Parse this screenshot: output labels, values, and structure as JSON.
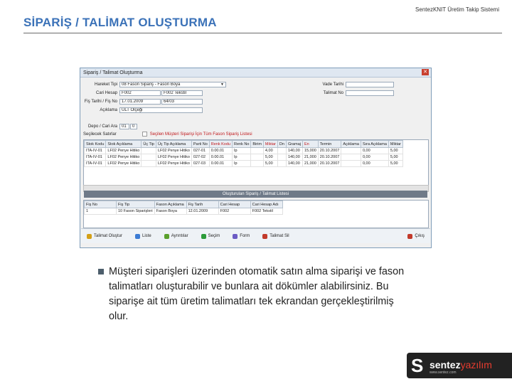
{
  "slide": {
    "title": "SİPARİŞ / TALİMAT OLUŞTURMA",
    "app_name": "SentezKNIT Üretim Takip Sistemi",
    "body_text": "Müşteri siparişleri üzerinden otomatik satın alma siparişi ve fason talimatları oluşturabilir ve bunlara ait dökümler alabilirsiniz. Bu siparişe ait tüm üretim talimatları tek ekrandan gerçekleştirilmiş olur."
  },
  "window": {
    "title": "Sipariş / Talimat Oluşturma",
    "close": "✕",
    "form": {
      "hareket_tipi_label": "Hareket Tipi",
      "hareket_tipi_value": "08 Fason Sipariş - Fason Boya",
      "cari_hesap_label": "Cari Hesap",
      "cari_hesap_code": "F002",
      "cari_hesap_name": "F002 Tekstil",
      "fis_tarihi_label": "Fiş Tarihi / Fiş No",
      "fis_tarihi_value": "17.01.2009",
      "fis_no_value": "64/03",
      "aciklama_label": "Açıklama",
      "aciklama_value": "ÜLT Ölçeği",
      "depo_label": "Depo / Cari Ara",
      "depo_value": "01",
      "depo_value2": "0",
      "secilecek_label": "Seçilecek Satırlar",
      "note": "Seçilen Müşteri Siparişi İçin Tüm Fason Sipariş Listesi"
    },
    "right_form": {
      "vade_label": "Vade Tarihi",
      "vade_value": "",
      "talimat_label": "Talimat No",
      "talimat_value": ""
    },
    "grid": {
      "headers": [
        "Stok Kodu",
        "Stok Açıklama",
        "Üç Tip",
        "Üç Tip Açıklama",
        "Parti No",
        "Renk Kodu",
        "Renk No",
        "Birim",
        "Miktar",
        "Dn",
        "Gramaj",
        "En",
        "Termin",
        "Açıklama",
        "Sıra Açıklama",
        "Miktar"
      ],
      "red_columns": [
        5,
        8,
        11
      ],
      "rows": [
        [
          "ITA-IV-01",
          "LF02 Penye Hitiko",
          "",
          "LF02 Penye Hitiko",
          "027-01",
          "0.00.01",
          "Ip",
          "",
          "4,00",
          "",
          "140,00",
          "15,000",
          "20.10.2007",
          "",
          "0,00",
          "5,00"
        ],
        [
          "ITA-IV-01",
          "LF02 Penye Hitiko",
          "",
          "LF02 Penye Hitiko",
          "027-02",
          "0.00.01",
          "Ip",
          "",
          "5,00",
          "",
          "140,00",
          "21,000",
          "20.10.2007",
          "",
          "0,00",
          "5,00"
        ],
        [
          "ITA-IV-01",
          "LF02 Penye Hitiko",
          "",
          "LF02 Penye Hitiko",
          "027-03",
          "0.00.01",
          "Ip",
          "",
          "5,00",
          "",
          "140,00",
          "21,000",
          "20.10.2007",
          "",
          "0,00",
          "5,00"
        ]
      ]
    },
    "sub_title": "Oluşturulan Sipariş / Talimat Listesi",
    "sub_grid": {
      "headers": [
        "Fiş No",
        "Fiş Tip",
        "Fason Açıklama",
        "Fiş Tarih",
        "Cari Hesap",
        "Cari Hesap Adı"
      ],
      "rows": [
        [
          "1",
          "10 Fason Siparişleri",
          "Fason Boya",
          "12.01.2009",
          "F002",
          "F002 Tekstil"
        ]
      ]
    },
    "toolbar": {
      "buttons": [
        "Talimat Oluştur",
        "Liste",
        "Ayrıntılar",
        "Seçim",
        "Form",
        "Talimat Sil",
        "Çıkış"
      ],
      "colors": [
        "#d4a017",
        "#3b7bd4",
        "#5aa02c",
        "#2c9b39",
        "#6b5bc4",
        "#c23a2b",
        "#c23a2b"
      ]
    }
  },
  "logo": {
    "mark": "S",
    "brand": "sentez",
    "brand_suffix": "yazılım",
    "url": "www.sentez.com"
  }
}
